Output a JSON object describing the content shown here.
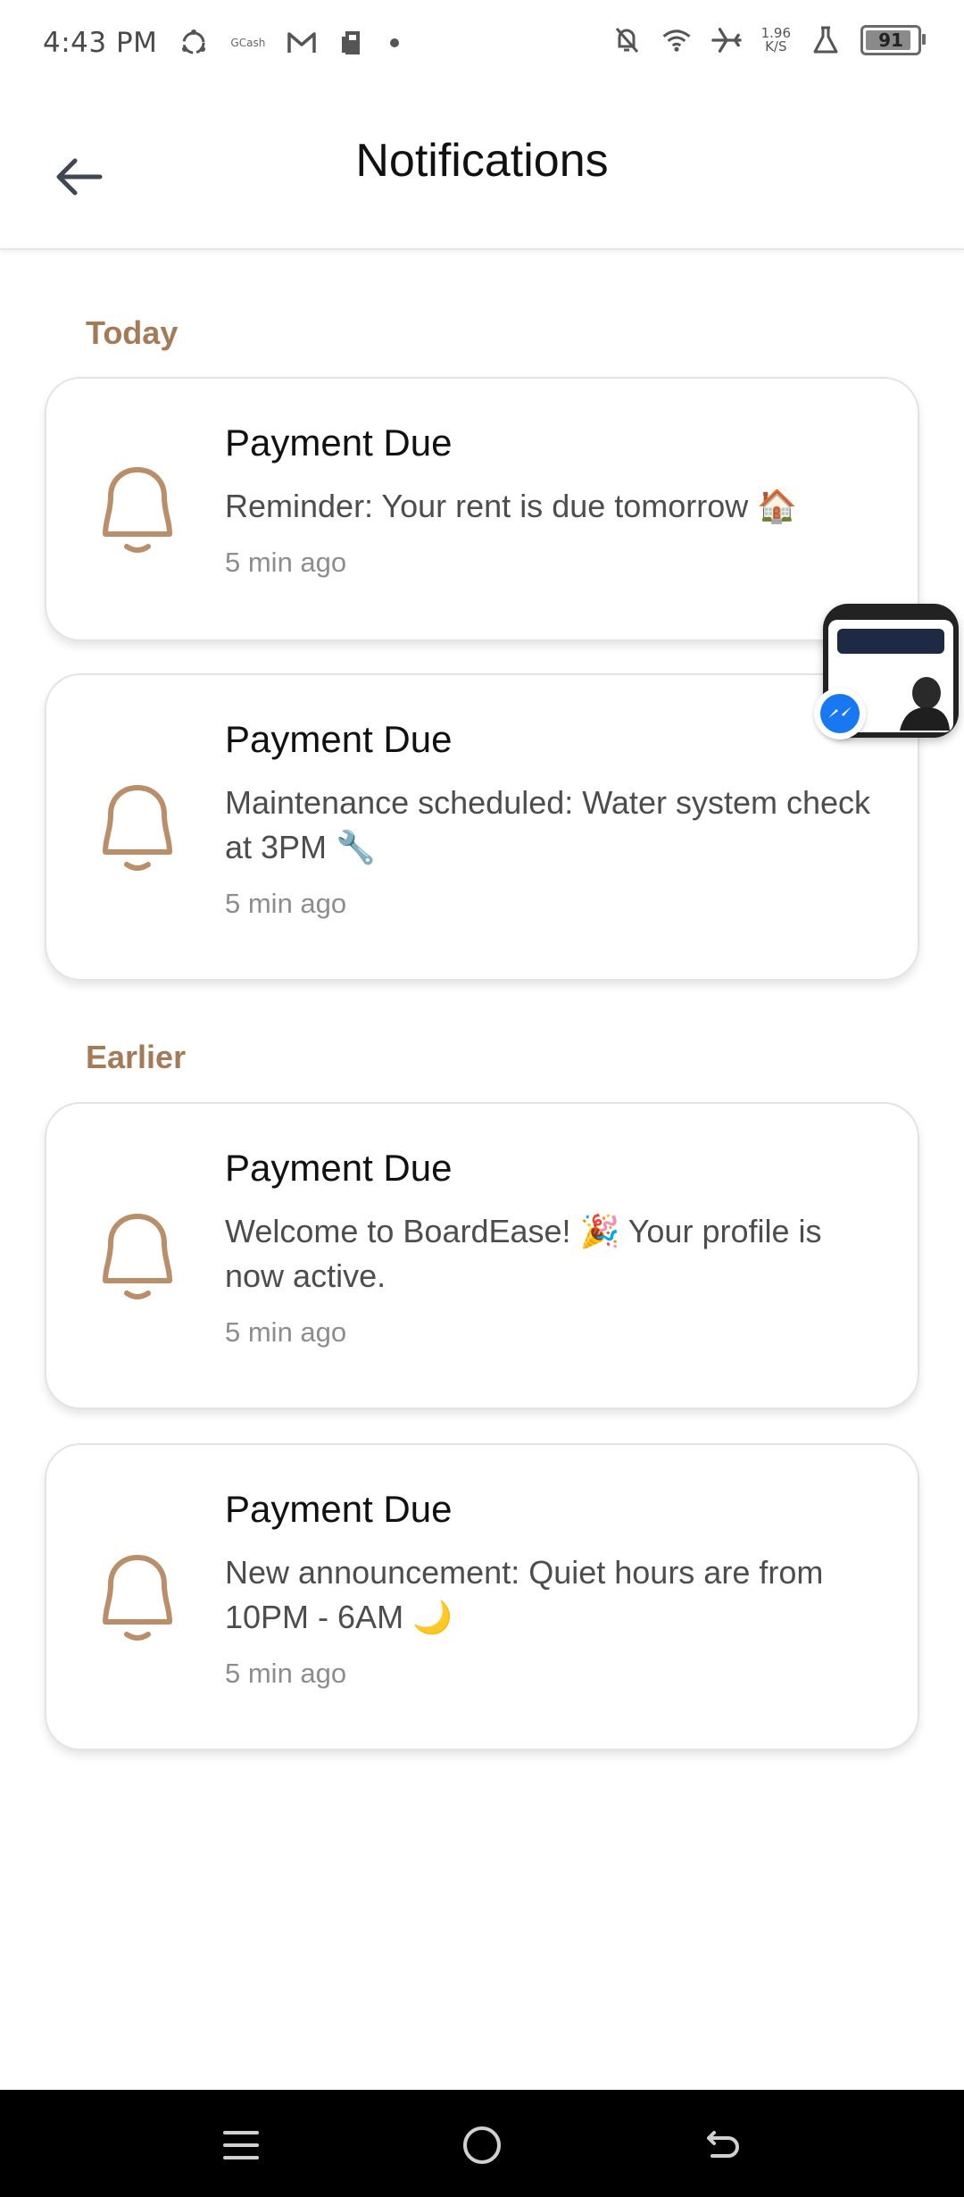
{
  "status_bar": {
    "time": "4:43 PM",
    "gcash_label": "GCash",
    "net_speed_value": "1.96",
    "net_speed_unit": "K/S",
    "battery": "91",
    "icons": [
      "sync-icon",
      "gcash-icon",
      "gmail-icon",
      "sim-icon",
      "dot-icon",
      "bell-off-icon",
      "wifi-icon",
      "airplane-icon",
      "flask-icon",
      "battery-icon"
    ]
  },
  "header": {
    "title": "Notifications",
    "back_icon": "arrow-left-icon"
  },
  "sections": {
    "today": "Today",
    "earlier": "Earlier"
  },
  "notifications": [
    {
      "title": "Payment Due",
      "message": "Reminder: Your rent is due tomorrow 🏠",
      "time": "5 min ago",
      "icon": "bell-icon"
    },
    {
      "title": "Payment Due",
      "message": "Maintenance scheduled: Water system check at 3PM 🔧",
      "time": "5 min ago",
      "icon": "bell-icon"
    },
    {
      "title": "Payment Due",
      "message": "Welcome to BoardEase! 🎉 Your profile is now active.",
      "time": "5 min ago",
      "icon": "bell-icon"
    },
    {
      "title": "Payment Due",
      "message": "New announcement: Quiet hours are from 10PM - 6AM 🌙",
      "time": "5 min ago",
      "icon": "bell-icon"
    }
  ],
  "overlay": {
    "chat_head_icon": "messenger-icon"
  },
  "nav_bar": {
    "icons": [
      "menu-icon",
      "home-circle-icon",
      "back-icon"
    ]
  },
  "colors": {
    "accent": "#a57a57",
    "bell": "#b98e68",
    "messenger": "#1877f2"
  }
}
